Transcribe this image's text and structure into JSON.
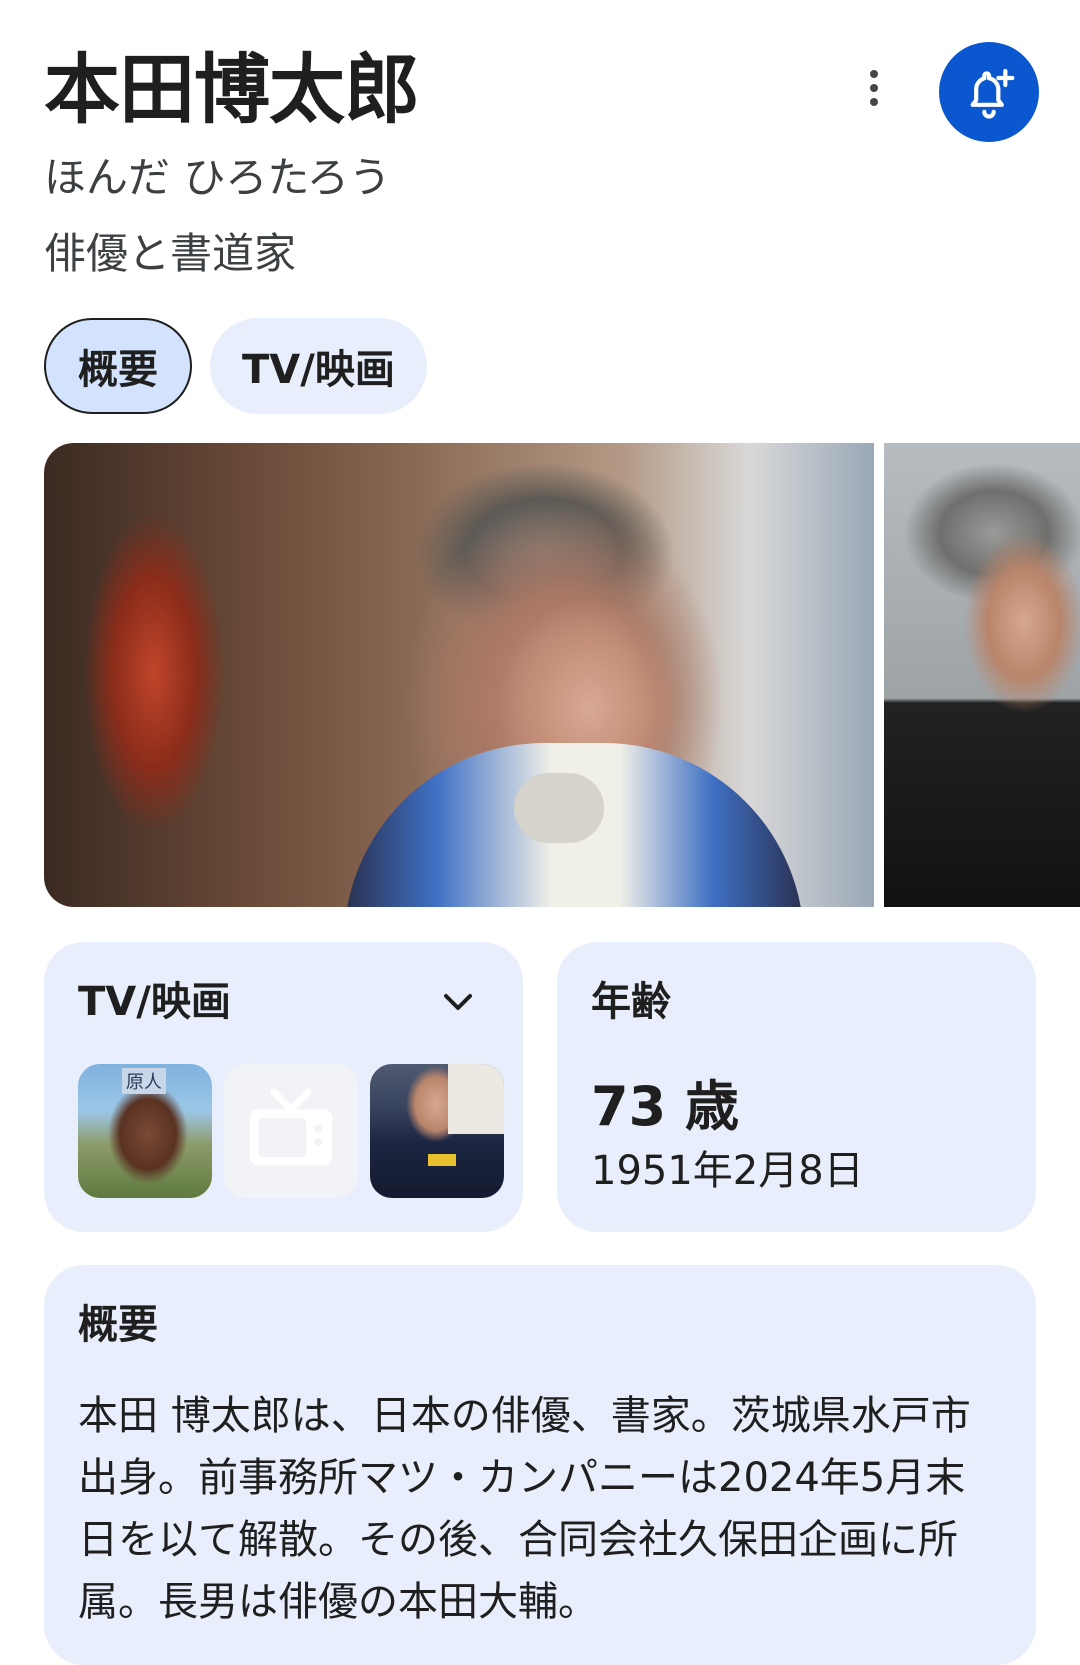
{
  "header": {
    "title": "本田博太郎",
    "reading": "ほんだ ひろたろう",
    "subtitle": "俳優と書道家"
  },
  "actions": {
    "more_icon": "more-vert-icon",
    "follow_icon": "bell-add-icon",
    "accent_color": "#0b57d0"
  },
  "chips": [
    {
      "label": "概要",
      "selected": true
    },
    {
      "label": "TV/映画",
      "selected": false
    }
  ],
  "tv_card": {
    "heading": "TV/映画",
    "expand_icon": "chevron-down-icon",
    "thumb1_tag": "原人",
    "placeholder_icon": "tv-icon"
  },
  "age_card": {
    "heading": "年齢",
    "value": "73 歳",
    "birthdate": "1951年2月8日"
  },
  "summary_card": {
    "heading": "概要",
    "text": "本田 博太郎は、日本の俳優、書家。茨城県水戸市出身。前事務所マツ・カンパニーは2024年5月末日を以て解散。その後、合同会社久保田企画に所属。長男は俳優の本田大輔。"
  }
}
